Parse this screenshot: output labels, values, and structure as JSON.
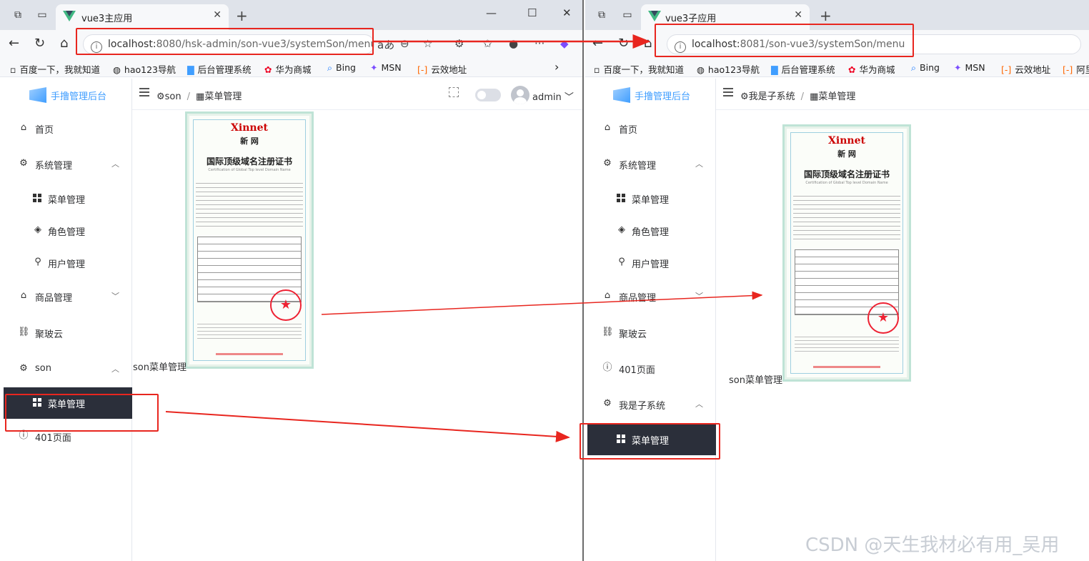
{
  "left": {
    "tab_title": "vue3主应用",
    "url_host": "localhost:",
    "url_rest": "8080/hsk-admin/son-vue3/systemSon/menu",
    "breadcrumb": [
      "son",
      "菜单管理"
    ],
    "user": "admin",
    "content_label": "son菜单管理",
    "menu": {
      "home": "首页",
      "system": "系统管理",
      "menu_mgmt": "菜单管理",
      "role_mgmt": "角色管理",
      "user_mgmt": "用户管理",
      "goods": "商品管理",
      "jupo": "聚玻云",
      "son": "son",
      "son_menu": "菜单管理",
      "page401": "401页面"
    }
  },
  "right": {
    "tab_title": "vue3子应用",
    "url_host": "localhost:",
    "url_rest": "8081/son-vue3/systemSon/menu",
    "breadcrumb": [
      "我是子系统",
      "菜单管理"
    ],
    "content_label": "son菜单管理",
    "menu": {
      "home": "首页",
      "system": "系统管理",
      "menu_mgmt": "菜单管理",
      "role_mgmt": "角色管理",
      "user_mgmt": "用户管理",
      "goods": "商品管理",
      "jupo": "聚玻云",
      "page401": "401页面",
      "child_sys": "我是子系统",
      "child_menu": "菜单管理"
    }
  },
  "logo_text": "手撸管理后台",
  "reading_mode": "aあ",
  "bookmarks": [
    "百度一下，我就知道",
    "hao123导航",
    "后台管理系统",
    "华为商城",
    "Bing",
    "MSN",
    "云效地址",
    "阿里"
  ],
  "certificate": {
    "brand": "Xinnet",
    "brand_cn": "新 网",
    "title": "国际顶级域名注册证书",
    "subtitle": "Certification of Global Top level Domain Name"
  },
  "watermark": "CSDN @天生我材必有用_吴用",
  "colors": {
    "highlight": "#e8261f",
    "active_menu": "#2b2f3a",
    "accent": "#409eff"
  }
}
